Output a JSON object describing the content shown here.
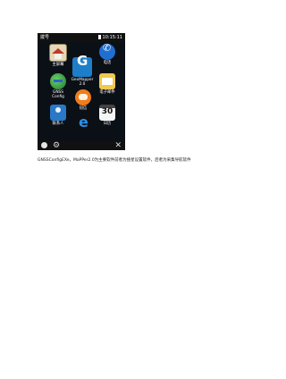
{
  "status": {
    "left": "拨号",
    "right": "10:15:11"
  },
  "apps": [
    {
      "label": "主屏幕"
    },
    {
      "label": "电话"
    },
    {
      "label": "GeoMapper 2.0"
    },
    {
      "label": "GNSS Config"
    },
    {
      "label": "电子邮件"
    },
    {
      "label": "短信"
    },
    {
      "label": "联系人"
    },
    {
      "label": "日历",
      "value": "30"
    }
  ],
  "caption": "GNSSConfigEXe，MaPPer2.0为主要软件前者为搜星设置软件，后者为采集导航软件"
}
